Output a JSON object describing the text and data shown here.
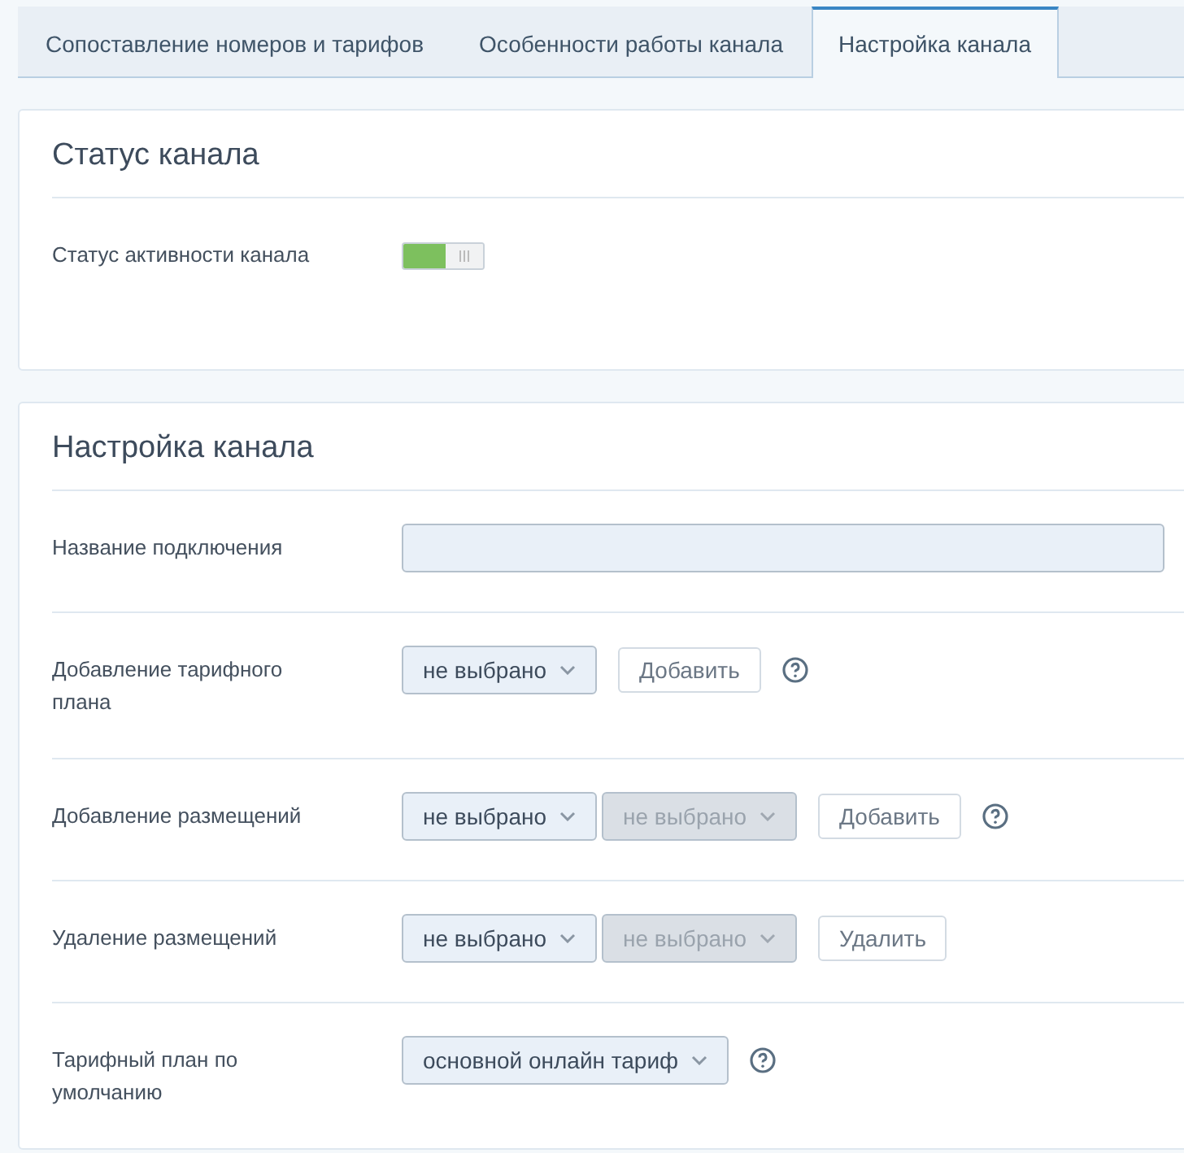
{
  "tabs": [
    {
      "label": "Сопоставление номеров и тарифов",
      "selected": false
    },
    {
      "label": "Особенности работы канала",
      "selected": false
    },
    {
      "label": "Настройка канала",
      "selected": true
    }
  ],
  "status_card": {
    "title": "Статус канала",
    "label": "Статус активности канала",
    "switch_on": true
  },
  "settings_card": {
    "title": "Настройка канала",
    "rows": [
      {
        "label": "Название подключения",
        "kind": "input"
      },
      {
        "label": "Добавление тарифного плана",
        "kind": "selects",
        "selects": [
          {
            "value": "не выбрано",
            "disabled": false
          }
        ],
        "button": "Добавить",
        "help": true
      },
      {
        "label": "Добавление размещений",
        "kind": "selects",
        "selects": [
          {
            "value": "не выбрано",
            "disabled": false
          },
          {
            "value": "не выбрано",
            "disabled": true
          }
        ],
        "button": "Добавить",
        "help": true
      },
      {
        "label": "Удаление размещений",
        "kind": "selects",
        "selects": [
          {
            "value": "не выбрано",
            "disabled": false
          },
          {
            "value": "не выбрано",
            "disabled": true
          }
        ],
        "button": "Удалить",
        "help": false
      },
      {
        "label": "Тарифный план по умолчанию",
        "kind": "selects",
        "selects": [
          {
            "value": "основной онлайн тариф",
            "disabled": false
          }
        ],
        "help": true
      }
    ]
  }
}
